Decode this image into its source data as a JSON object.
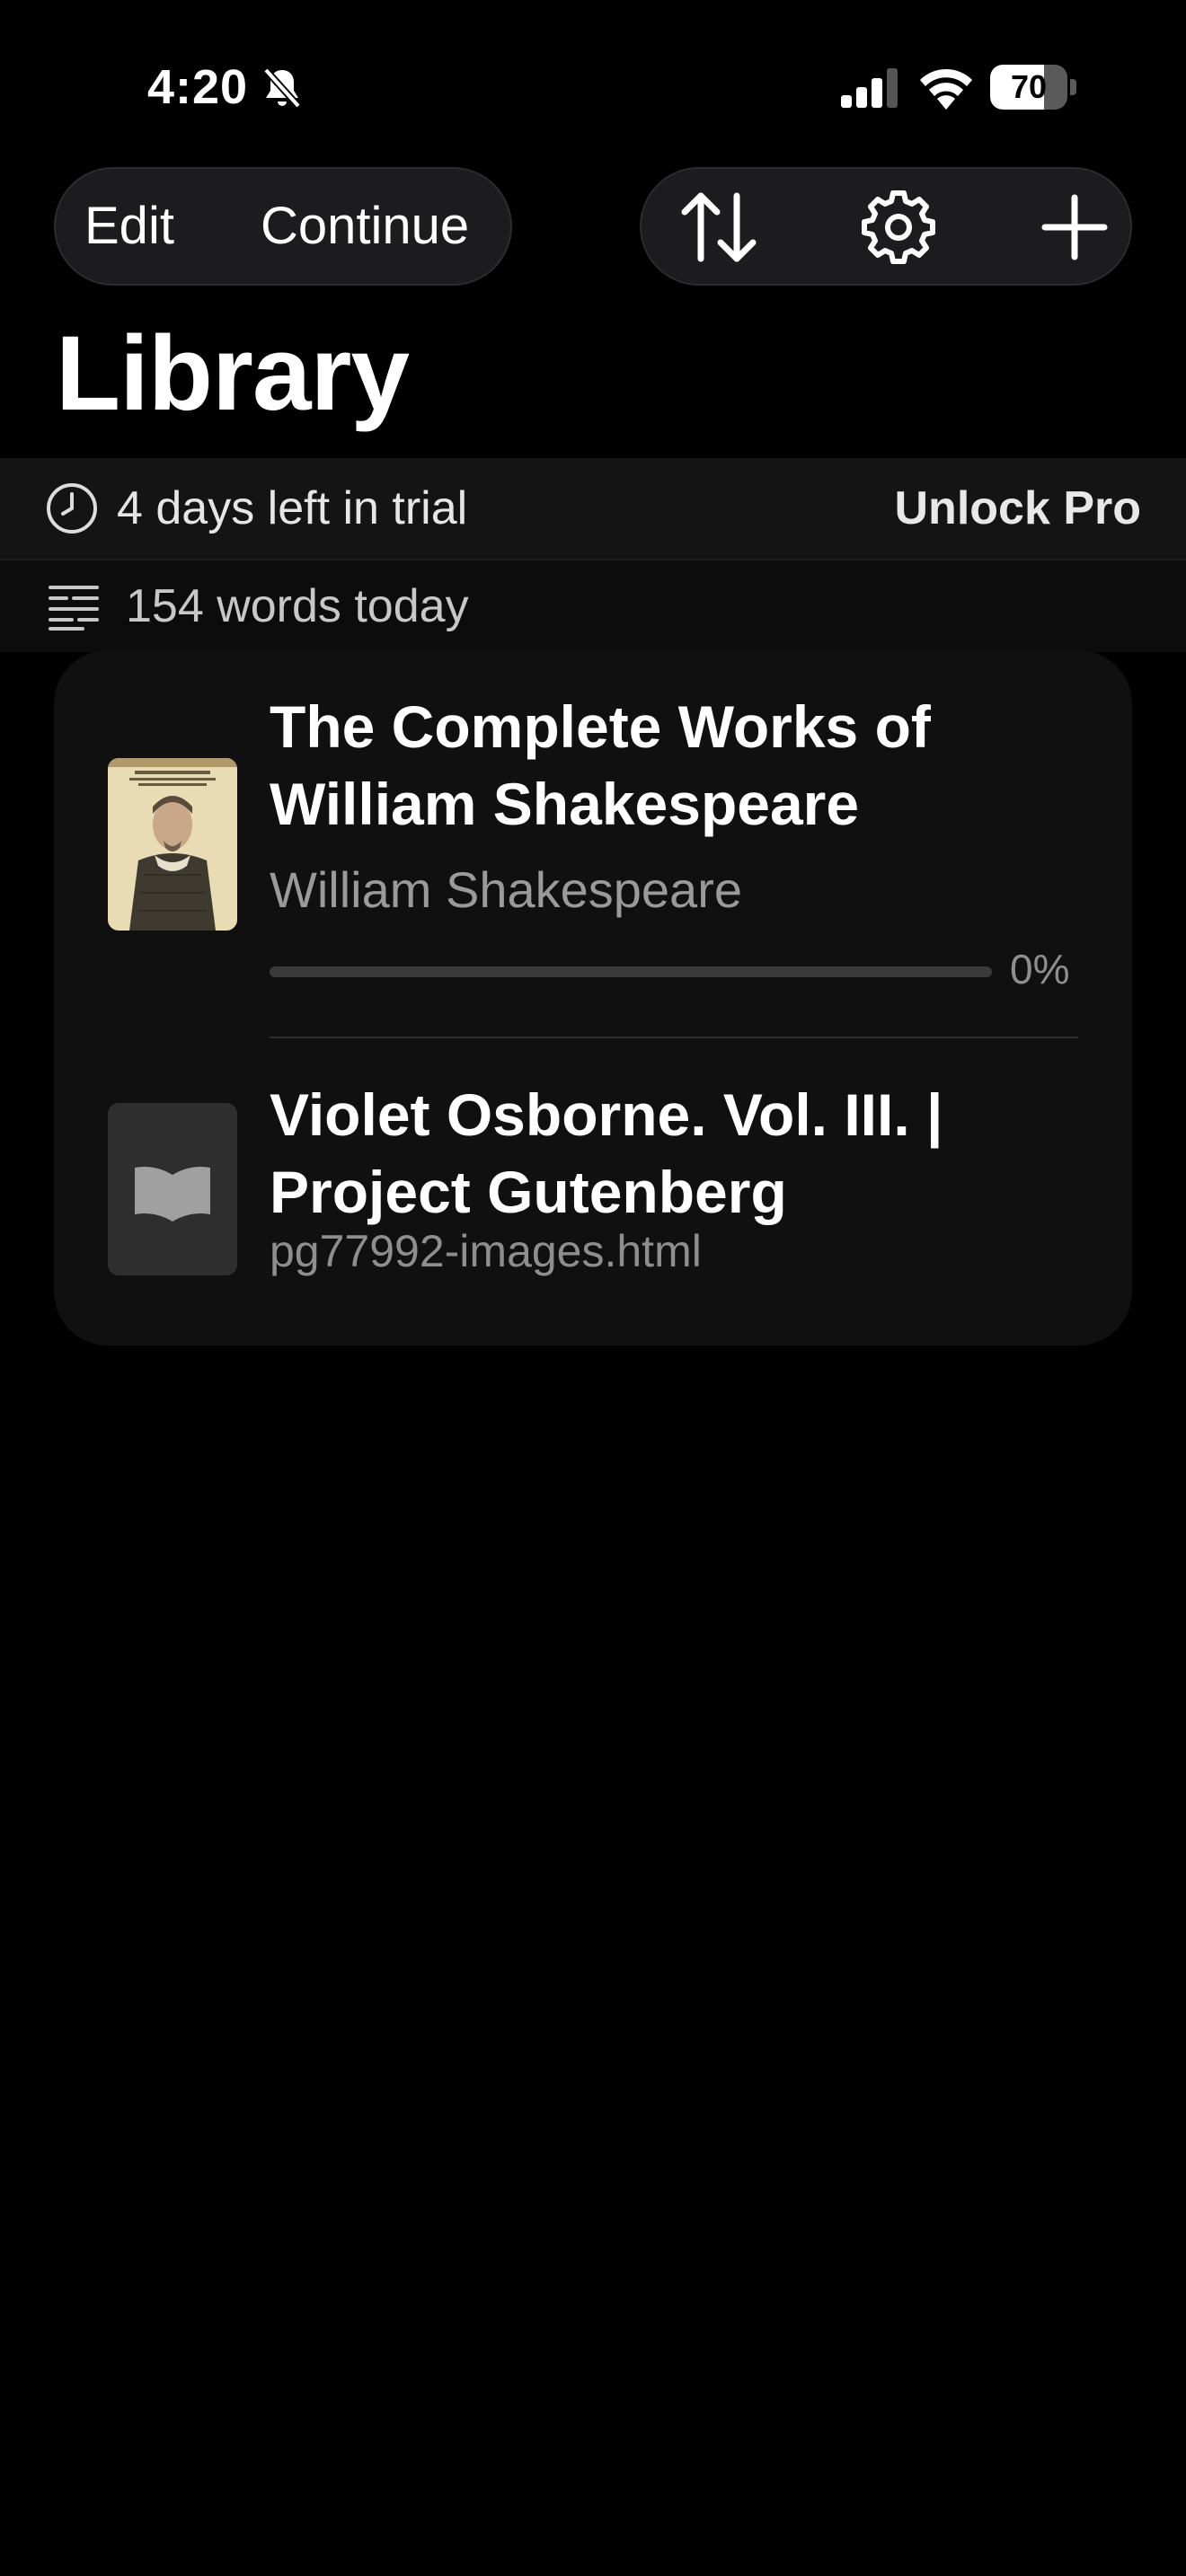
{
  "status_bar": {
    "time": "4:20",
    "battery_level": "70",
    "battery_fraction": 0.7
  },
  "toolbar": {
    "edit_label": "Edit",
    "continue_label": "Continue",
    "icons": [
      "sort-icon",
      "gear-icon",
      "plus-icon"
    ]
  },
  "page": {
    "title": "Library"
  },
  "trial_banner": {
    "text": "4 days left in trial",
    "unlock_label": "Unlock Pro"
  },
  "words_banner": {
    "text": "154 words today"
  },
  "books": [
    {
      "title": "The Complete Works of William Shakespeare",
      "author": "William Shakespeare",
      "progress": 0,
      "progress_label": "0%"
    },
    {
      "title": "Violet Osborne. Vol. III. | Project Gutenberg",
      "file": "pg77992-images.html"
    }
  ],
  "colors": {
    "background": "#000000",
    "card": "#101010",
    "banner": "#141414",
    "secondary_text": "#9a9a9a"
  }
}
